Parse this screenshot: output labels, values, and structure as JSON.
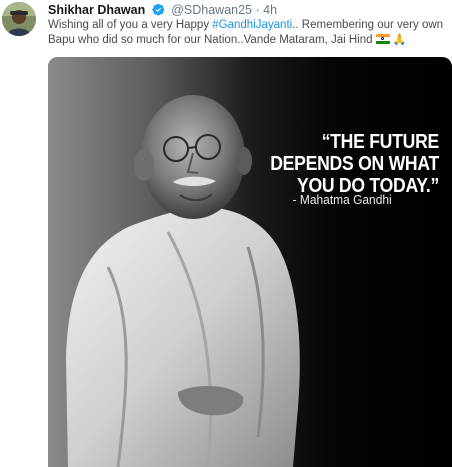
{
  "tweet": {
    "author_name": "Shikhar Dhawan",
    "handle": "@SDhawan25",
    "separator": "·",
    "time": "4h",
    "text_before_hashtag": "Wishing all of you a very Happy ",
    "hashtag": "#GandhiJayanti",
    "text_after_hashtag": ".. Remembering our very own Bapu who did so much for our Nation..Vande Mataram, Jai Hind",
    "emoji": [
      "indian-flag",
      "folded-hands"
    ],
    "pray_glyph": "🙏"
  },
  "media": {
    "quote": "“THE FUTURE DEPENDS ON WHAT YOU DO TODAY.”",
    "attribution": "- Mahatma Gandhi"
  },
  "colors": {
    "link": "#1b95e0",
    "verified": "#1da1f2",
    "muted_text": "#657786"
  }
}
